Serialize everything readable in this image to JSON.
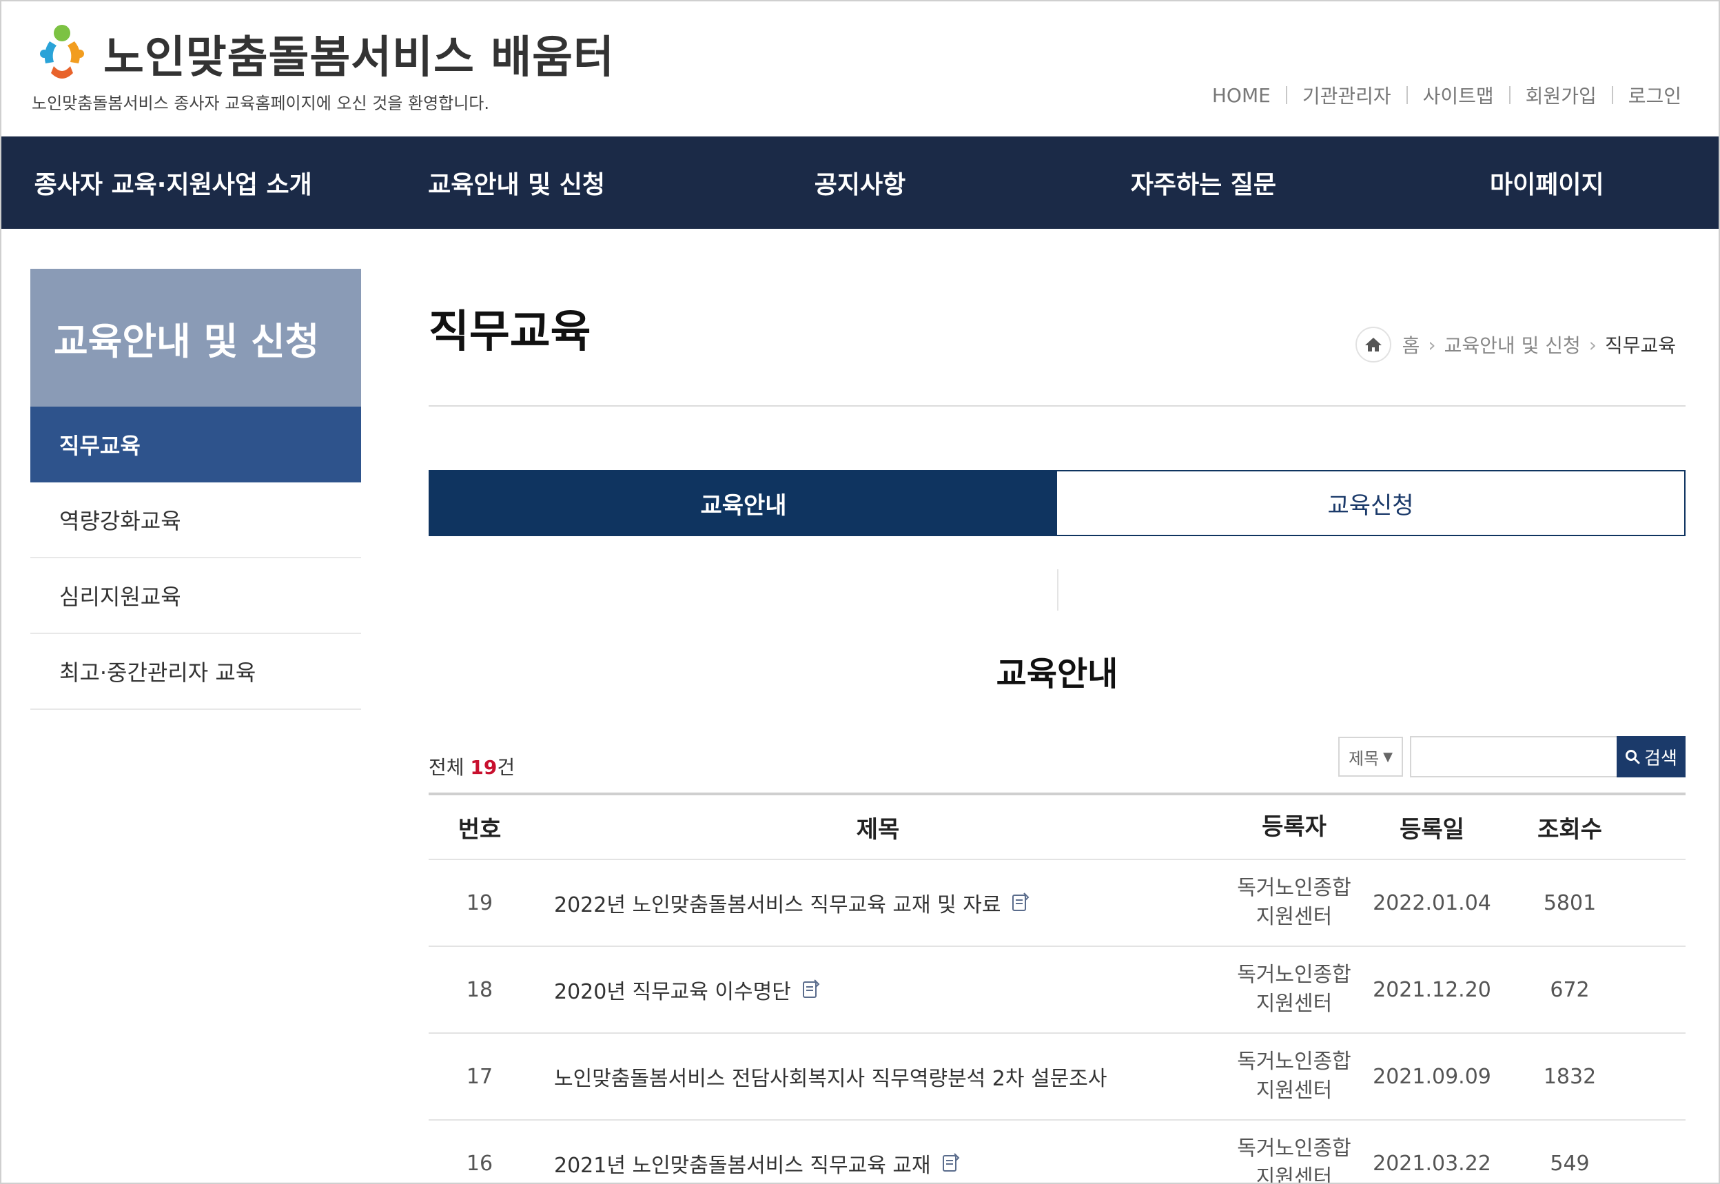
{
  "header": {
    "site_title": "노인맞춤돌봄서비스 배움터",
    "slogan": "노인맞춤돌봄서비스 종사자 교육홈페이지에 오신 것을 환영합니다.",
    "top_links": [
      "HOME",
      "기관관리자",
      "사이트맵",
      "회원가입",
      "로그인"
    ]
  },
  "gnb": [
    "종사자 교육·지원사업 소개",
    "교육안내 및 신청",
    "공지사항",
    "자주하는 질문",
    "마이페이지"
  ],
  "sidebar": {
    "title": "교육안내 및 신청",
    "items": [
      {
        "label": "직무교육",
        "active": true
      },
      {
        "label": "역량강화교육",
        "active": false
      },
      {
        "label": "심리지원교육",
        "active": false
      },
      {
        "label": "최고·중간관리자 교육",
        "active": false
      }
    ]
  },
  "page": {
    "title": "직무교육",
    "breadcrumb": [
      "홈",
      "교육안내 및 신청",
      "직무교육"
    ]
  },
  "tabs": [
    {
      "label": "교육안내",
      "active": true
    },
    {
      "label": "교육신청",
      "active": false
    }
  ],
  "section_title": "교육안내",
  "total": {
    "prefix": "전체 ",
    "count": "19",
    "suffix": "건"
  },
  "search": {
    "select_value": "제목",
    "button_label": "검색",
    "query": ""
  },
  "board": {
    "columns": [
      "번호",
      "제목",
      "등록자",
      "등록일",
      "조회수"
    ],
    "rows": [
      {
        "no": "19",
        "title": "2022년 노인맞춤돌봄서비스 직무교육 교재 및 자료",
        "attach": true,
        "writer_line1": "독거노인종합",
        "writer_line2": "지원센터",
        "date": "2022.01.04",
        "views": "5801"
      },
      {
        "no": "18",
        "title": "2020년 직무교육 이수명단",
        "attach": true,
        "writer_line1": "독거노인종합",
        "writer_line2": "지원센터",
        "date": "2021.12.20",
        "views": "672"
      },
      {
        "no": "17",
        "title": "노인맞춤돌봄서비스 전담사회복지사 직무역량분석 2차 설문조사",
        "attach": false,
        "writer_line1": "독거노인종합",
        "writer_line2": "지원센터",
        "date": "2021.09.09",
        "views": "1832"
      },
      {
        "no": "16",
        "title": "2021년 노인맞춤돌봄서비스 직무교육 교재",
        "attach": true,
        "writer_line1": "독거노인종합",
        "writer_line2": "지원센터",
        "date": "2021.03.22",
        "views": "549"
      }
    ]
  },
  "colors": {
    "navy": "#1b2a47",
    "tab_navy": "#0f3460",
    "sidebar_title": "#8a9bb6",
    "sidebar_active": "#2e538c",
    "count_red": "#c8102e"
  }
}
